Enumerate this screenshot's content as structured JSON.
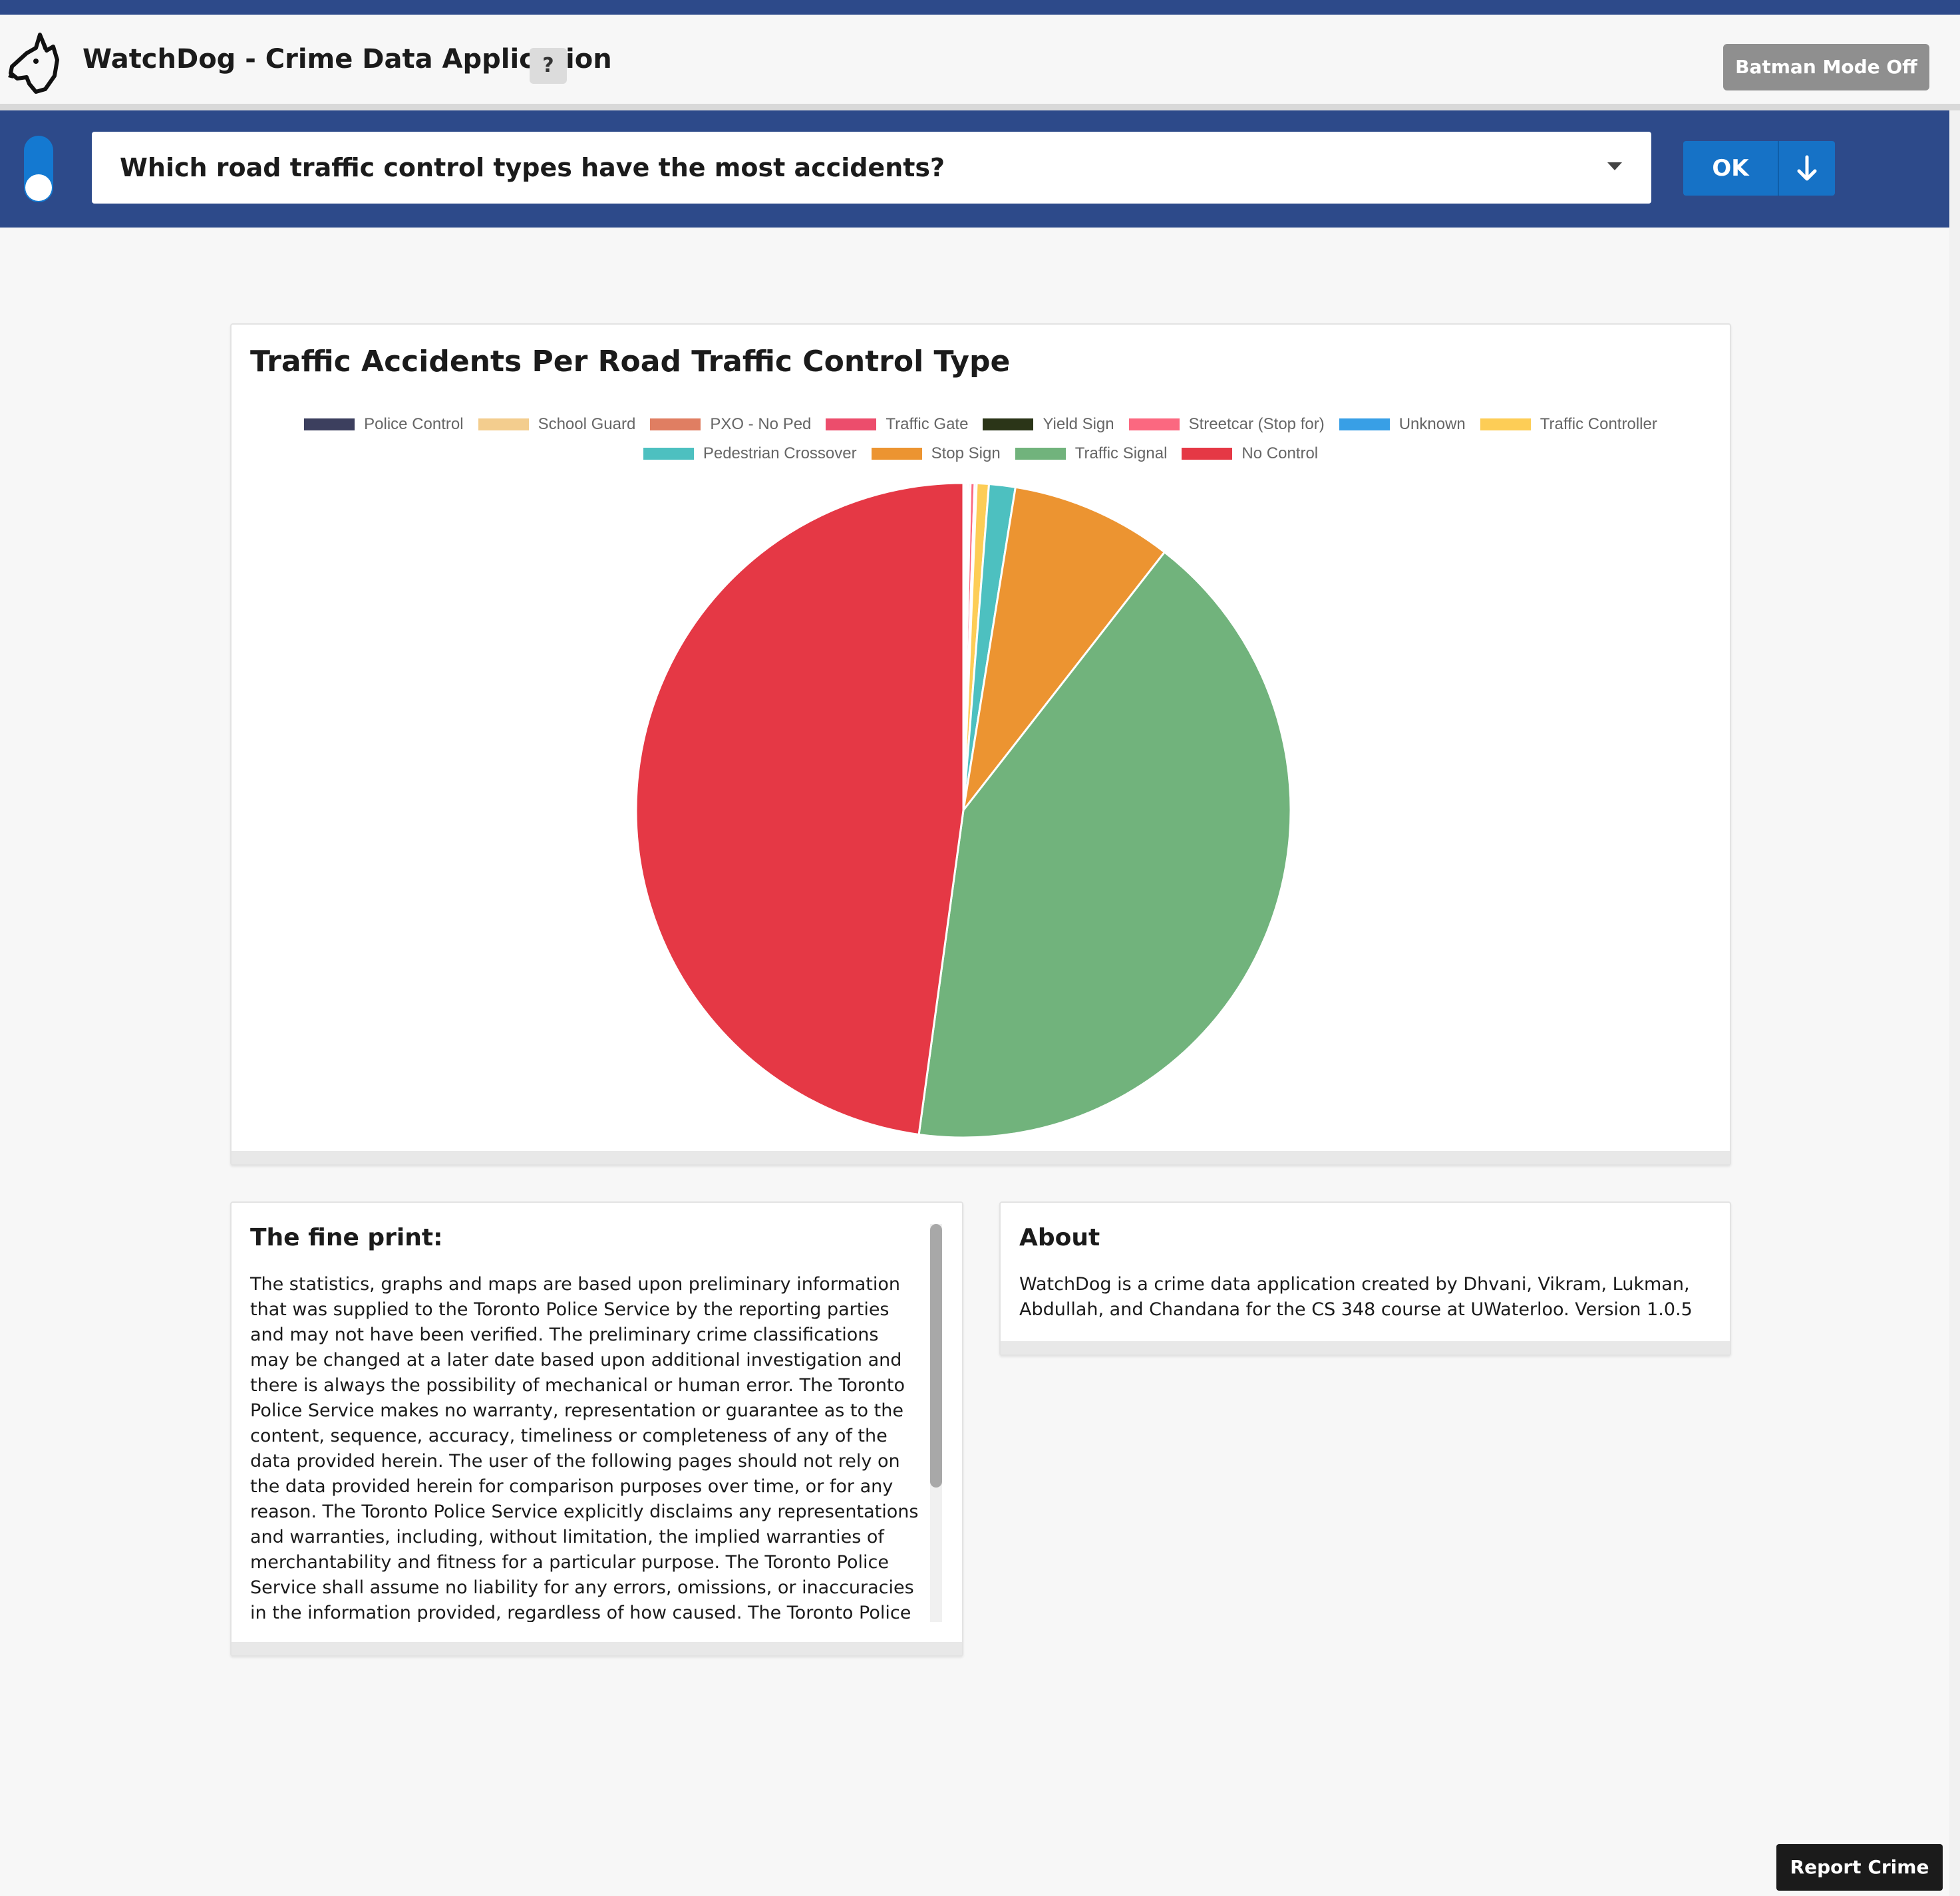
{
  "header": {
    "app_title": "WatchDog - Crime Data Application",
    "help_label": "?",
    "batman_label": "Batman Mode Off",
    "logo_icon": "dog-head-icon"
  },
  "toolbar": {
    "question": "Which road traffic control types have the most accidents?",
    "ok_label": "OK",
    "download_icon": "arrow-down-icon"
  },
  "chart_card": {
    "title": "Traffic Accidents Per Road Traffic Control Type"
  },
  "chart_data": {
    "type": "pie",
    "title": "Traffic Accidents Per Road Traffic Control Type",
    "legend_position": "top",
    "categories": [
      "Police Control",
      "School Guard",
      "PXO - No Ped",
      "Traffic Gate",
      "Yield Sign",
      "Streetcar (Stop for)",
      "Unknown",
      "Traffic Controller",
      "Pedestrian Crossover",
      "Stop Sign",
      "Traffic Signal",
      "No Control"
    ],
    "values": [
      0.05,
      0.05,
      0.1,
      0.05,
      0.1,
      0.2,
      0.1,
      0.6,
      1.3,
      8.0,
      41.7,
      47.9
    ],
    "colors": [
      "#3c3f5e",
      "#f3cd8e",
      "#e07e62",
      "#ec4d6c",
      "#2b3518",
      "#fb6880",
      "#389fe6",
      "#fdcd56",
      "#4dc0c0",
      "#ec9431",
      "#71b37c",
      "#e53845"
    ]
  },
  "fine_print": {
    "heading": "The fine print:",
    "body": "The statistics, graphs and maps are based upon preliminary information that was supplied to the Toronto Police Service by the reporting parties and may not have been verified. The preliminary crime classifications may be changed at a later date based upon additional investigation and there is always the possibility of mechanical or human error. The Toronto Police Service makes no warranty, representation or guarantee as to the content, sequence, accuracy, timeliness or completeness of any of the data provided herein. The user of the following pages should not rely on the data provided herein for comparison purposes over time, or for any reason. The Toronto Police Service explicitly disclaims any representations and warranties, including, without limitation, the implied warranties of merchantability and fitness for a particular purpose. The Toronto Police Service shall assume no liability for any errors, omissions, or inaccuracies in the information provided, regardless of how caused. The Toronto Police Service will not be responsible for the use of, or the results"
  },
  "about": {
    "heading": "About",
    "body": "WatchDog is a crime data application created by Dhvani, Vikram, Lukman, Abdullah, and Chandana for the CS 348 course at UWaterloo. Version 1.0.5"
  },
  "report_label": "Report Crime"
}
